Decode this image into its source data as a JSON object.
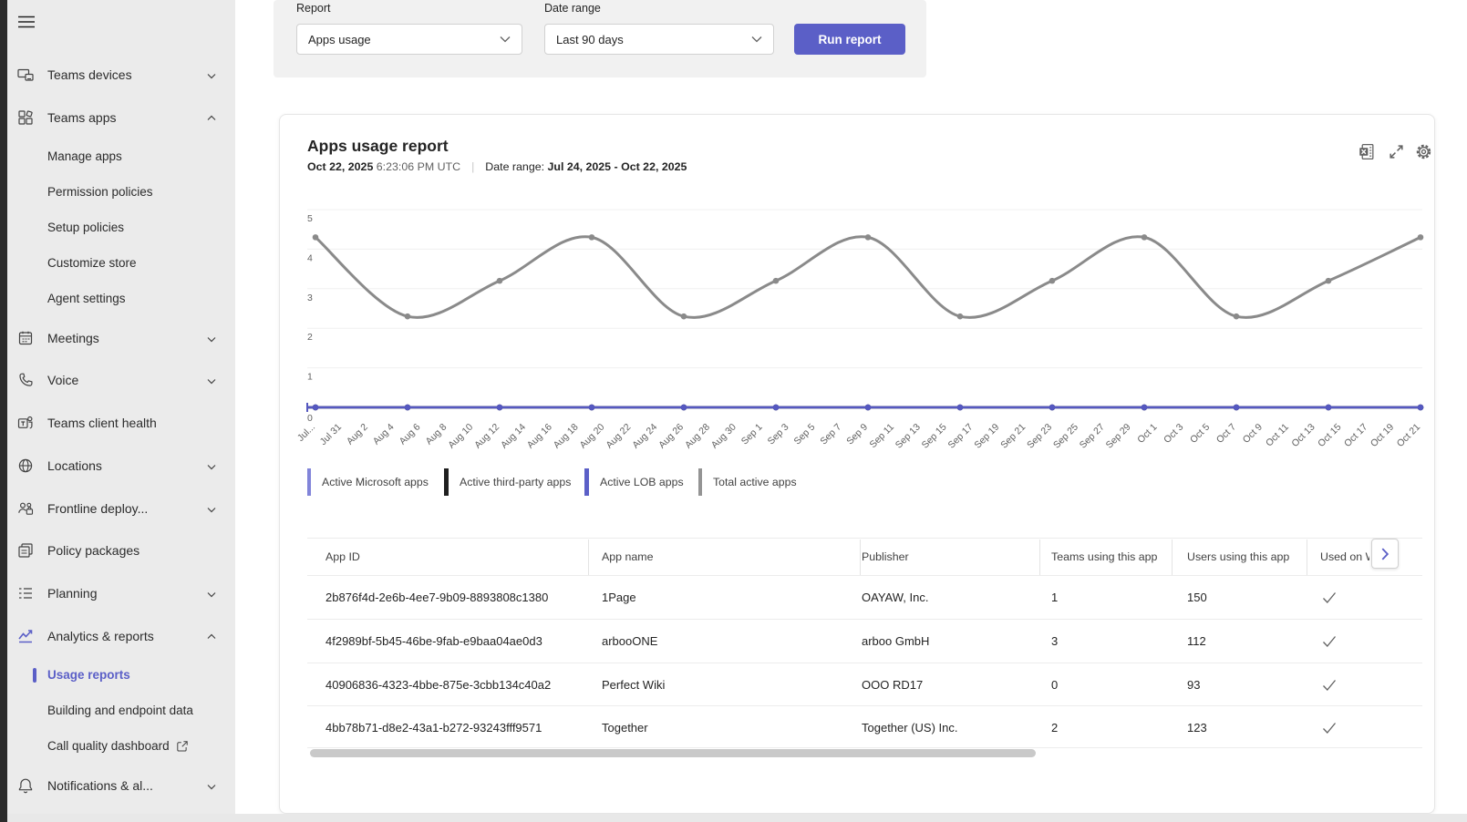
{
  "sidebar": {
    "items": [
      {
        "label": "Teams devices"
      },
      {
        "label": "Teams apps"
      },
      {
        "label": "Manage apps"
      },
      {
        "label": "Permission policies"
      },
      {
        "label": "Setup policies"
      },
      {
        "label": "Customize store"
      },
      {
        "label": "Agent settings"
      },
      {
        "label": "Meetings"
      },
      {
        "label": "Voice"
      },
      {
        "label": "Teams client health"
      },
      {
        "label": "Locations"
      },
      {
        "label": "Frontline deploy..."
      },
      {
        "label": "Policy packages"
      },
      {
        "label": "Planning"
      },
      {
        "label": "Analytics & reports"
      },
      {
        "label": "Usage reports",
        "selected": true
      },
      {
        "label": "Building and endpoint data"
      },
      {
        "label": "Call quality dashboard"
      },
      {
        "label": "Notifications & al..."
      }
    ]
  },
  "filters": {
    "report_label": "Report",
    "report_value": "Apps usage",
    "date_range_label": "Date range",
    "date_range_value": "Last 90 days",
    "run_button": "Run report"
  },
  "report": {
    "title": "Apps usage report",
    "generated_date": "Oct 22, 2025",
    "generated_time": " 6:23:06 PM UTC",
    "separator": "|",
    "date_range_label": "Date range: ",
    "date_range_value": "Jul 24, 2025 - Oct 22, 2025",
    "toolbar_icons": [
      "excel-export",
      "expand",
      "settings"
    ]
  },
  "legend": {
    "items": [
      {
        "label": "Active Microsoft apps",
        "color": "#8184d9"
      },
      {
        "label": "Active third-party apps",
        "color": "#1f1f1f"
      },
      {
        "label": "Active LOB apps",
        "color": "#5b5fc7"
      },
      {
        "label": "Total active apps",
        "color": "#949494"
      }
    ]
  },
  "chart_data": {
    "type": "line",
    "title": "Apps usage report",
    "xlabel": "",
    "ylabel": "",
    "ylim": [
      0,
      5
    ],
    "yticks": [
      0,
      1,
      2,
      3,
      4,
      5
    ],
    "grid": "horizontal",
    "legend_position": "bottom",
    "x_tick_labels": [
      "Jul...",
      "Jul 31",
      "Aug 2",
      "Aug 4",
      "Aug 6",
      "Aug 8",
      "Aug 10",
      "Aug 12",
      "Aug 14",
      "Aug 16",
      "Aug 18",
      "Aug 20",
      "Aug 22",
      "Aug 24",
      "Aug 26",
      "Aug 28",
      "Aug 30",
      "Sep 1",
      "Sep 3",
      "Sep 5",
      "Sep 7",
      "Sep 9",
      "Sep 11",
      "Sep 13",
      "Sep 15",
      "Sep 17",
      "Sep 19",
      "Sep 21",
      "Sep 23",
      "Sep 25",
      "Sep 27",
      "Sep 29",
      "Oct 1",
      "Oct 3",
      "Oct 5",
      "Oct 7",
      "Oct 9",
      "Oct 11",
      "Oct 13",
      "Oct 15",
      "Oct 17",
      "Oct 19",
      "Oct 21"
    ],
    "x_points": [
      "Jul 29",
      "Aug 5",
      "Aug 12",
      "Aug 19",
      "Aug 26",
      "Sep 2",
      "Sep 9",
      "Sep 16",
      "Sep 23",
      "Sep 30",
      "Oct 7",
      "Oct 14",
      "Oct 21"
    ],
    "series": [
      {
        "name": "Active Microsoft apps",
        "color": "#8184d9",
        "values": [
          0,
          0,
          0,
          0,
          0,
          0,
          0,
          0,
          0,
          0,
          0,
          0,
          0
        ]
      },
      {
        "name": "Active third-party apps",
        "color": "#1f1f1f",
        "values": [
          0,
          0,
          0,
          0,
          0,
          0,
          0,
          0,
          0,
          0,
          0,
          0,
          0
        ]
      },
      {
        "name": "Active LOB apps",
        "color": "#5558c0",
        "values": [
          0,
          0,
          0,
          0,
          0,
          0,
          0,
          0,
          0,
          0,
          0,
          0,
          0
        ]
      },
      {
        "name": "Total active apps",
        "color": "#8a8a8a",
        "values": [
          4.3,
          2.3,
          3.2,
          4.3,
          2.3,
          3.2,
          4.3,
          2.3,
          3.2,
          4.3,
          2.3,
          3.2,
          4.3
        ]
      }
    ]
  },
  "table": {
    "headers": [
      "App ID",
      "App name",
      "Publisher",
      "Teams using this app",
      "Users using this app",
      "Used on W"
    ],
    "rows": [
      [
        "2b876f4d-2e6b-4ee7-9b09-8893808c1380",
        "1Page",
        "OAYAW, Inc.",
        "1",
        "150",
        "checked"
      ],
      [
        "4f2989bf-5b45-46be-9fab-e9baa04ae0d3",
        "arbooONE",
        "arboo GmbH",
        "3",
        "112",
        "checked"
      ],
      [
        "40906836-4323-4bbe-875e-3cbb134c40a2",
        "Perfect Wiki",
        "OOO RD17",
        "0",
        "93",
        "checked"
      ],
      [
        "4bb78b71-d8e2-43a1-b272-93243fff9571",
        "Together",
        "Together (US) Inc.",
        "2",
        "123",
        "checked"
      ]
    ],
    "next_icon": "chevron-right"
  }
}
